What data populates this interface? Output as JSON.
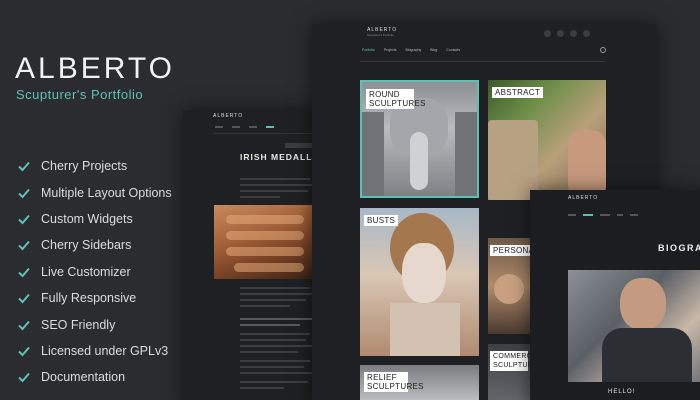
{
  "brand": {
    "title": "ALBERTO",
    "subtitle": "Scupturer's Portfolio"
  },
  "features": [
    "Cherry Projects",
    "Multiple Layout Options",
    "Custom Widgets",
    "Cherry Sidebars",
    "Live Customizer",
    "Fully Responsive",
    "SEO Friendly",
    "Licensed under GPLv3",
    "Documentation"
  ],
  "accent_color": "#5fc1b4",
  "screen_back": {
    "logo": "ALBERTO",
    "post_title": "IRISH MEDALLION CAST IN"
  },
  "screen_main": {
    "logo": "ALBERTO",
    "logo_tagline": "Scupturer's Portfolio",
    "nav": [
      "Portfolio",
      "Projects",
      "Biography",
      "Blog",
      "Contacts"
    ],
    "tiles": {
      "round": "ROUND SCULPTURES",
      "abstract": "ABSTRACT",
      "busts": "BUSTS",
      "personal": "PERSONAL",
      "commercial": "COMMERCIAL SCULPTURES",
      "relief": "RELIEF SCULPTURES"
    }
  },
  "screen_bio": {
    "logo": "ALBERTO",
    "title": "BIOGRAPH",
    "greeting": "HELLO!"
  }
}
